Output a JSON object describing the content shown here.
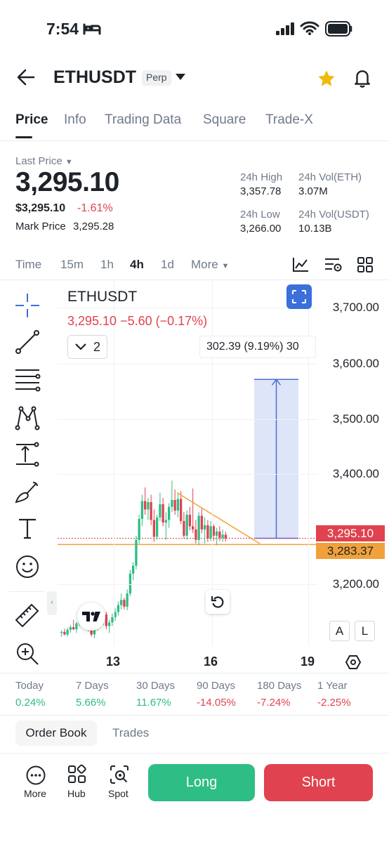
{
  "status_bar": {
    "time": "7:54"
  },
  "header": {
    "symbol": "ETHUSDT",
    "badge": "Perp"
  },
  "tabs": [
    {
      "label": "Price",
      "active": true
    },
    {
      "label": "Info"
    },
    {
      "label": "Trading Data"
    },
    {
      "label": "Square"
    },
    {
      "label": "Trade-X"
    }
  ],
  "ticker": {
    "last_price_label": "Last Price",
    "last_price": "3,295.10",
    "usd_price": "$3,295.10",
    "change_pct": "-1.61%",
    "mark_price_label": "Mark Price",
    "mark_price": "3,295.28",
    "stats": {
      "high_label": "24h High",
      "high": "3,357.78",
      "vol_eth_label": "24h Vol(ETH)",
      "vol_eth": "3.07M",
      "low_label": "24h Low",
      "low": "3,266.00",
      "vol_usdt_label": "24h Vol(USDT)",
      "vol_usdt": "10.13B"
    }
  },
  "timeframes": [
    {
      "label": "Time"
    },
    {
      "label": "15m"
    },
    {
      "label": "1h"
    },
    {
      "label": "4h",
      "active": true
    },
    {
      "label": "1d"
    },
    {
      "label": "More"
    }
  ],
  "chart": {
    "symbol": "ETHUSDT",
    "ohlc_line": "3,295.10  −5.60 (−0.17%)",
    "indicator_count": "2",
    "measure_label": "302.39 (9.19%) 30",
    "price_axis": [
      "3,700.00",
      "3,600.00",
      "3,500.00",
      "3,400.00",
      "3,200.00"
    ],
    "last_price_tag": "3,295.10",
    "line_price_tag": "3,283.37",
    "x_labels": [
      "13",
      "16",
      "19"
    ],
    "scale_buttons": [
      "A",
      "L"
    ],
    "colors": {
      "up": "#2ebd85",
      "down": "#e0424f",
      "trendline": "#f0a13c",
      "measure": "#4a6fd6"
    }
  },
  "chart_data": {
    "type": "candlestick",
    "symbol": "ETHUSDT",
    "interval": "4h",
    "x_tick_labels": [
      "13",
      "16",
      "19"
    ],
    "y_tick_labels": [
      "3,200.00",
      "3,400.00",
      "3,500.00",
      "3,600.00",
      "3,700.00"
    ],
    "ylim": [
      3090,
      3785
    ],
    "last_price": 3295.1,
    "horizontal_line": 3283.37,
    "measure_range": {
      "from": 3295.1,
      "to": 3597.49,
      "diff_label": "302.39 (9.19%)"
    },
    "candles": [
      [
        3115,
        3120,
        3108,
        3117
      ],
      [
        3117,
        3123,
        3110,
        3112
      ],
      [
        3112,
        3125,
        3108,
        3121
      ],
      [
        3121,
        3130,
        3115,
        3126
      ],
      [
        3126,
        3140,
        3120,
        3122
      ],
      [
        3122,
        3136,
        3115,
        3133
      ],
      [
        3133,
        3150,
        3128,
        3140
      ],
      [
        3140,
        3148,
        3132,
        3135
      ],
      [
        3135,
        3145,
        3125,
        3128
      ],
      [
        3128,
        3138,
        3118,
        3122
      ],
      [
        3122,
        3132,
        3108,
        3112
      ],
      [
        3112,
        3130,
        3105,
        3125
      ],
      [
        3125,
        3160,
        3120,
        3148
      ],
      [
        3148,
        3165,
        3138,
        3142
      ],
      [
        3142,
        3158,
        3130,
        3150
      ],
      [
        3150,
        3155,
        3122,
        3128
      ],
      [
        3128,
        3140,
        3115,
        3135
      ],
      [
        3135,
        3152,
        3128,
        3145
      ],
      [
        3145,
        3162,
        3138,
        3155
      ],
      [
        3155,
        3175,
        3148,
        3168
      ],
      [
        3168,
        3190,
        3160,
        3178
      ],
      [
        3178,
        3182,
        3160,
        3165
      ],
      [
        3165,
        3198,
        3158,
        3190
      ],
      [
        3190,
        3235,
        3185,
        3228
      ],
      [
        3228,
        3250,
        3215,
        3243
      ],
      [
        3243,
        3300,
        3236,
        3292
      ],
      [
        3292,
        3340,
        3285,
        3332
      ],
      [
        3332,
        3378,
        3318,
        3366
      ],
      [
        3366,
        3392,
        3340,
        3350
      ],
      [
        3350,
        3372,
        3330,
        3364
      ],
      [
        3364,
        3378,
        3320,
        3330
      ],
      [
        3330,
        3350,
        3288,
        3298
      ],
      [
        3298,
        3340,
        3292,
        3335
      ],
      [
        3335,
        3382,
        3328,
        3360
      ],
      [
        3360,
        3372,
        3318,
        3325
      ],
      [
        3325,
        3345,
        3292,
        3330
      ],
      [
        3330,
        3362,
        3315,
        3355
      ],
      [
        3355,
        3405,
        3345,
        3368
      ],
      [
        3368,
        3388,
        3340,
        3348
      ],
      [
        3348,
        3380,
        3335,
        3370
      ],
      [
        3370,
        3385,
        3322,
        3328
      ],
      [
        3328,
        3345,
        3295,
        3300
      ],
      [
        3300,
        3348,
        3292,
        3340
      ],
      [
        3340,
        3355,
        3310,
        3318
      ],
      [
        3318,
        3390,
        3305,
        3312
      ],
      [
        3312,
        3330,
        3285,
        3292
      ],
      [
        3292,
        3345,
        3282,
        3338
      ],
      [
        3338,
        3352,
        3305,
        3312
      ],
      [
        3312,
        3335,
        3285,
        3320
      ],
      [
        3320,
        3330,
        3288,
        3295
      ],
      [
        3295,
        3328,
        3290,
        3318
      ],
      [
        3318,
        3322,
        3290,
        3300
      ],
      [
        3300,
        3315,
        3282,
        3308
      ],
      [
        3308,
        3318,
        3290,
        3296
      ],
      [
        3296,
        3312,
        3288,
        3302
      ],
      [
        3302,
        3308,
        3289,
        3295
      ]
    ]
  },
  "performance": [
    {
      "label": "Today",
      "value": "0.24%",
      "dir": "pos"
    },
    {
      "label": "7 Days",
      "value": "5.66%",
      "dir": "pos"
    },
    {
      "label": "30 Days",
      "value": "11.67%",
      "dir": "pos"
    },
    {
      "label": "90 Days",
      "value": "-14.05%",
      "dir": "neg"
    },
    {
      "label": "180 Days",
      "value": "-7.24%",
      "dir": "neg"
    },
    {
      "label": "1 Year",
      "value": "-2.25%",
      "dir": "neg"
    }
  ],
  "book_tabs": {
    "order_book": "Order Book",
    "trades": "Trades"
  },
  "bottom_nav": {
    "more": "More",
    "hub": "Hub",
    "spot": "Spot",
    "long": "Long",
    "short": "Short"
  }
}
